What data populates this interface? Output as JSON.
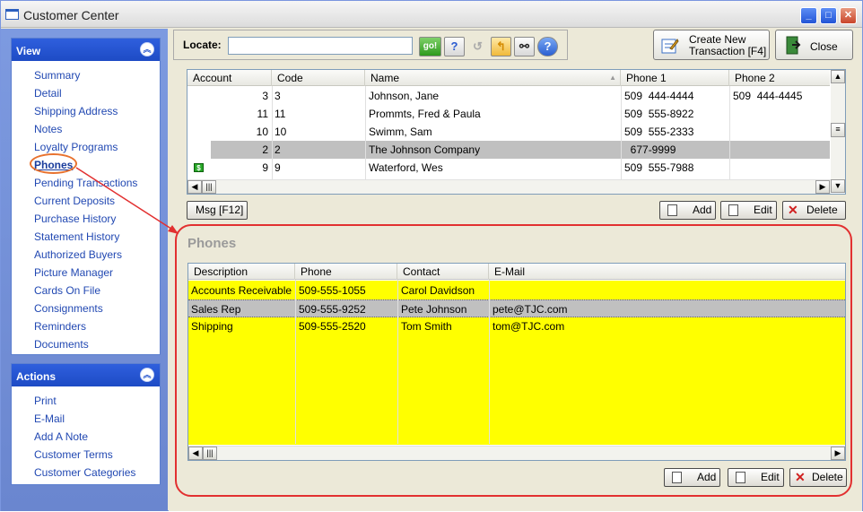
{
  "window": {
    "title": "Customer Center",
    "controls": [
      "_",
      "□",
      "✕"
    ]
  },
  "view_panel": {
    "title": "View",
    "items": [
      "Summary",
      "Detail",
      "Shipping Address",
      "Notes",
      "Loyalty Programs",
      "Phones",
      "Pending Transactions",
      "Current Deposits",
      "Purchase History",
      "Statement History",
      "Authorized Buyers",
      "Picture Manager",
      "Cards On File",
      "Consignments",
      "Reminders",
      "Documents"
    ],
    "selected": "Phones"
  },
  "actions_panel": {
    "title": "Actions",
    "items": [
      "Print",
      "E-Mail",
      "Add A Note",
      "Customer Terms",
      "Customer Categories"
    ]
  },
  "toolbar": {
    "locate_label": "Locate:",
    "locate_value": "",
    "go_label": "go!",
    "create_line1": "Create New",
    "create_line2": "Transaction [F4]",
    "close_label": "Close"
  },
  "customers_grid": {
    "columns": [
      "Account",
      "Code",
      "Name",
      "Phone 1",
      "Phone 2"
    ],
    "rows": [
      {
        "account": "3",
        "code": "3",
        "name": "Johnson, Jane",
        "phone1": "509  444-4444",
        "phone2": "509  444-4445",
        "selected": false,
        "flag": false
      },
      {
        "account": "11",
        "code": "11",
        "name": "Prommts, Fred & Paula",
        "phone1": "509  555-8922",
        "phone2": "",
        "selected": false,
        "flag": false
      },
      {
        "account": "10",
        "code": "10",
        "name": "Swimm, Sam",
        "phone1": "509  555-2333",
        "phone2": "",
        "selected": false,
        "flag": false
      },
      {
        "account": "2",
        "code": "2",
        "name": "The Johnson Company",
        "phone1": "  677-9999",
        "phone2": "",
        "selected": true,
        "flag": false
      },
      {
        "account": "9",
        "code": "9",
        "name": "Waterford, Wes",
        "phone1": "509  555-7988",
        "phone2": "",
        "selected": false,
        "flag": true
      }
    ],
    "msg_label": "Msg [F12]",
    "add_label": "Add",
    "edit_label": "Edit",
    "delete_label": "Delete"
  },
  "phones": {
    "title": "Phones",
    "columns": [
      "Description",
      "Phone",
      "Contact",
      "E-Mail"
    ],
    "rows": [
      {
        "description": "Accounts Receivable",
        "phone": "509-555-1055",
        "contact": "Carol Davidson",
        "email": "",
        "selected": false
      },
      {
        "description": "Sales Rep",
        "phone": "509-555-9252",
        "contact": "Pete Johnson",
        "email": "pete@TJC.com",
        "selected": true
      },
      {
        "description": "Shipping",
        "phone": "509-555-2520",
        "contact": "Tom Smith",
        "email": "tom@TJC.com",
        "selected": false
      }
    ],
    "add_label": "Add",
    "edit_label": "Edit",
    "delete_label": "Delete"
  },
  "colors": {
    "highlight_yellow": "#ffff00",
    "selected_row": "#c0c0c0",
    "annotation_red": "#e23030",
    "annotation_orange": "#e8722e"
  }
}
